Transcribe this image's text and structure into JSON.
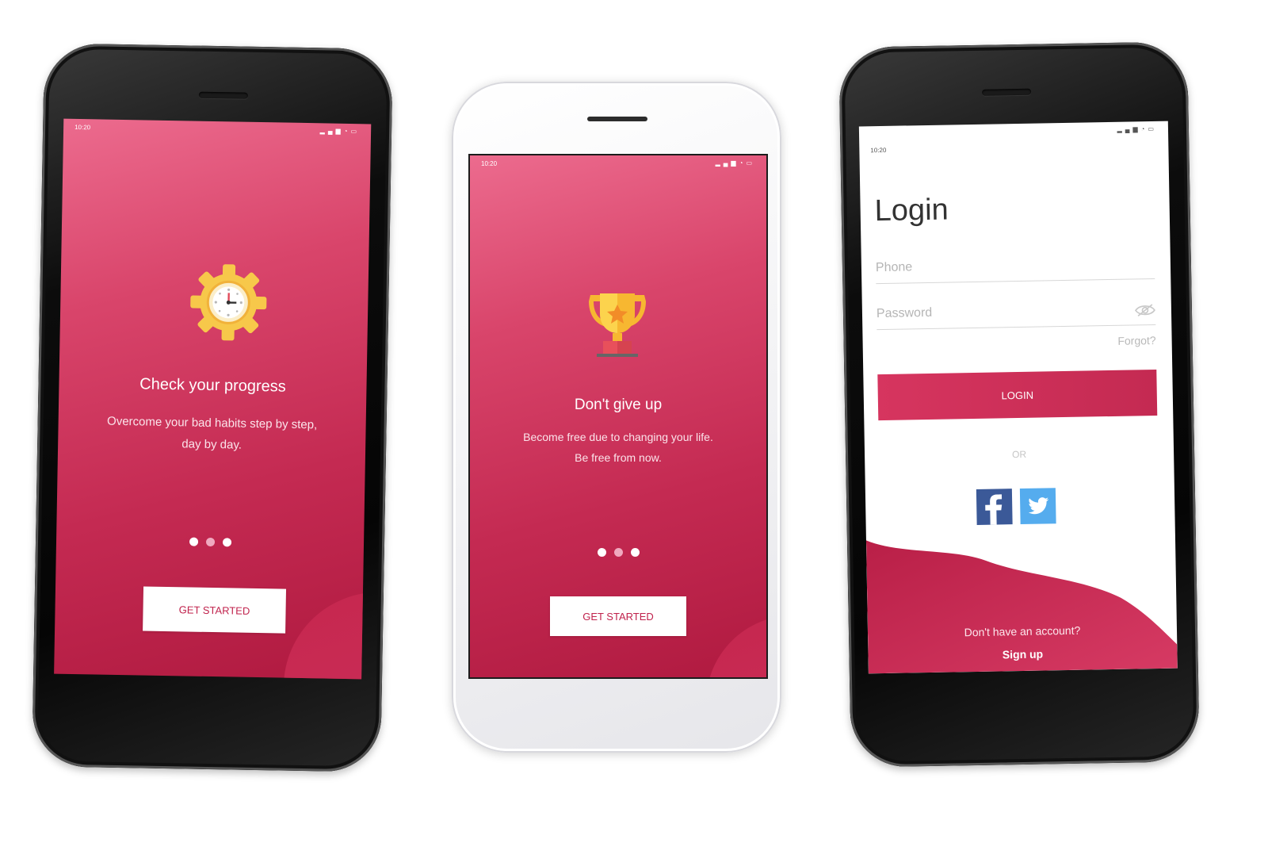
{
  "status_bar": {
    "time": "10:20"
  },
  "colors": {
    "accent": "#c42a52",
    "accent_light": "#ec6b8e",
    "facebook": "#3b5998",
    "twitter": "#55acee"
  },
  "onboarding_1": {
    "icon": "gear-clock-icon",
    "title": "Check your progress",
    "subtitle_line1": "Overcome your bad habits step by step,",
    "subtitle_line2": "day by day.",
    "button": "GET STARTED",
    "pages": 3
  },
  "onboarding_2": {
    "icon": "trophy-icon",
    "title": "Don't give up",
    "subtitle_line1": "Become free due to changing your life.",
    "subtitle_line2": "Be free from now.",
    "button": "GET STARTED",
    "pages": 3
  },
  "login": {
    "title": "Login",
    "phone_placeholder": "Phone",
    "password_placeholder": "Password",
    "forgot": "Forgot?",
    "button": "LOGIN",
    "or": "OR",
    "social": [
      "facebook-icon",
      "twitter-icon"
    ],
    "no_account": "Don't have an account?",
    "signup": "Sign up"
  }
}
